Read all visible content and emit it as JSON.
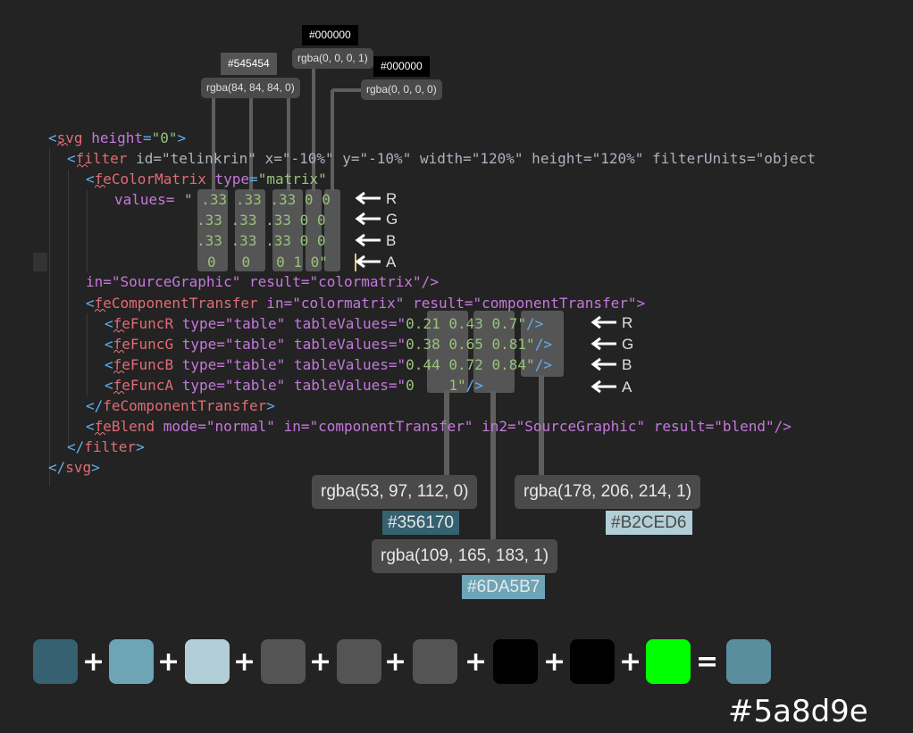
{
  "top_tooltips": {
    "hex_gray": "#545454",
    "rgba_gray": "rgba(84, 84, 84, 0)",
    "hex_black_1": "#000000",
    "rgba_black_1": "rgba(0, 0, 0, 1)",
    "hex_black_2": "#000000",
    "rgba_black_2": "rgba(0, 0, 0, 0)"
  },
  "code": {
    "svg_open": "svg",
    "svg_height_attr": "height",
    "svg_height_val": "\"0\"",
    "filter_tag": "filter",
    "filter_attrs": " id=\"telinkrin\" x=\"-10%\" y=\"-10%\" width=\"120%\" height=\"120%\" filterUnits=\"object",
    "cm_tag": "feColorMatrix",
    "cm_type": "type",
    "cm_type_val": "\"matrix\"",
    "values_attr": "values=",
    "matrix_rows": [
      [
        "\" .33",
        ".33",
        ".33",
        "0",
        "0"
      ],
      [
        ".33",
        ".33",
        ".33",
        "0",
        "0"
      ],
      [
        ".33",
        ".33",
        ".33",
        "0",
        "0"
      ],
      [
        "0",
        "0",
        "0",
        "1",
        "0\""
      ]
    ],
    "in_line": "in=\"SourceGraphic\" result=\"colormatrix\"/>",
    "ct_tag": "feComponentTransfer",
    "ct_attrs": " in=\"colormatrix\" result=\"componentTransfer\">",
    "func_r": "feFuncR",
    "func_g": "feFuncG",
    "func_b": "feFuncB",
    "func_a": "feFuncA",
    "func_attrs": " type=\"table\" tableValues=\"",
    "table_r": [
      "0.21",
      "0.43",
      "0.7\""
    ],
    "table_g": [
      "0.38",
      "0.65",
      "0.81\""
    ],
    "table_b": [
      "0.44",
      "0.72",
      "0.84\""
    ],
    "table_a": [
      "0",
      "1\""
    ],
    "func_close": "/>",
    "ct_close": "feComponentTransfer",
    "blend_tag": "feBlend",
    "blend_attrs": " mode=\"normal\" in=\"componentTransfer\" in2=\"SourceGraphic\" result=\"blend\"/>",
    "filter_close": "filter",
    "svg_close": "svg"
  },
  "arrow_labels": {
    "matrix": [
      "R",
      "G",
      "B",
      "A"
    ],
    "table": [
      "R",
      "G",
      "B",
      "A"
    ]
  },
  "bottom_tooltips": {
    "rgba_1": "rgba(53, 97, 112, 0)",
    "hex_1": "#356170",
    "rgba_2": "rgba(178, 206, 214, 1)",
    "hex_2": "#B2CED6",
    "rgba_3": "rgba(109, 165, 183, 1)",
    "hex_3": "#6DA5B7"
  },
  "swatches": [
    "#356170",
    "#6da5b7",
    "#b2ced6",
    "#545454",
    "#545454",
    "#545454",
    "#000000",
    "#000000",
    "#00ff00",
    "#5a8d9e"
  ],
  "operators": [
    "+",
    "+",
    "+",
    "+",
    "+",
    "+",
    "+",
    "+",
    "="
  ],
  "result_hex": "#5a8d9e"
}
